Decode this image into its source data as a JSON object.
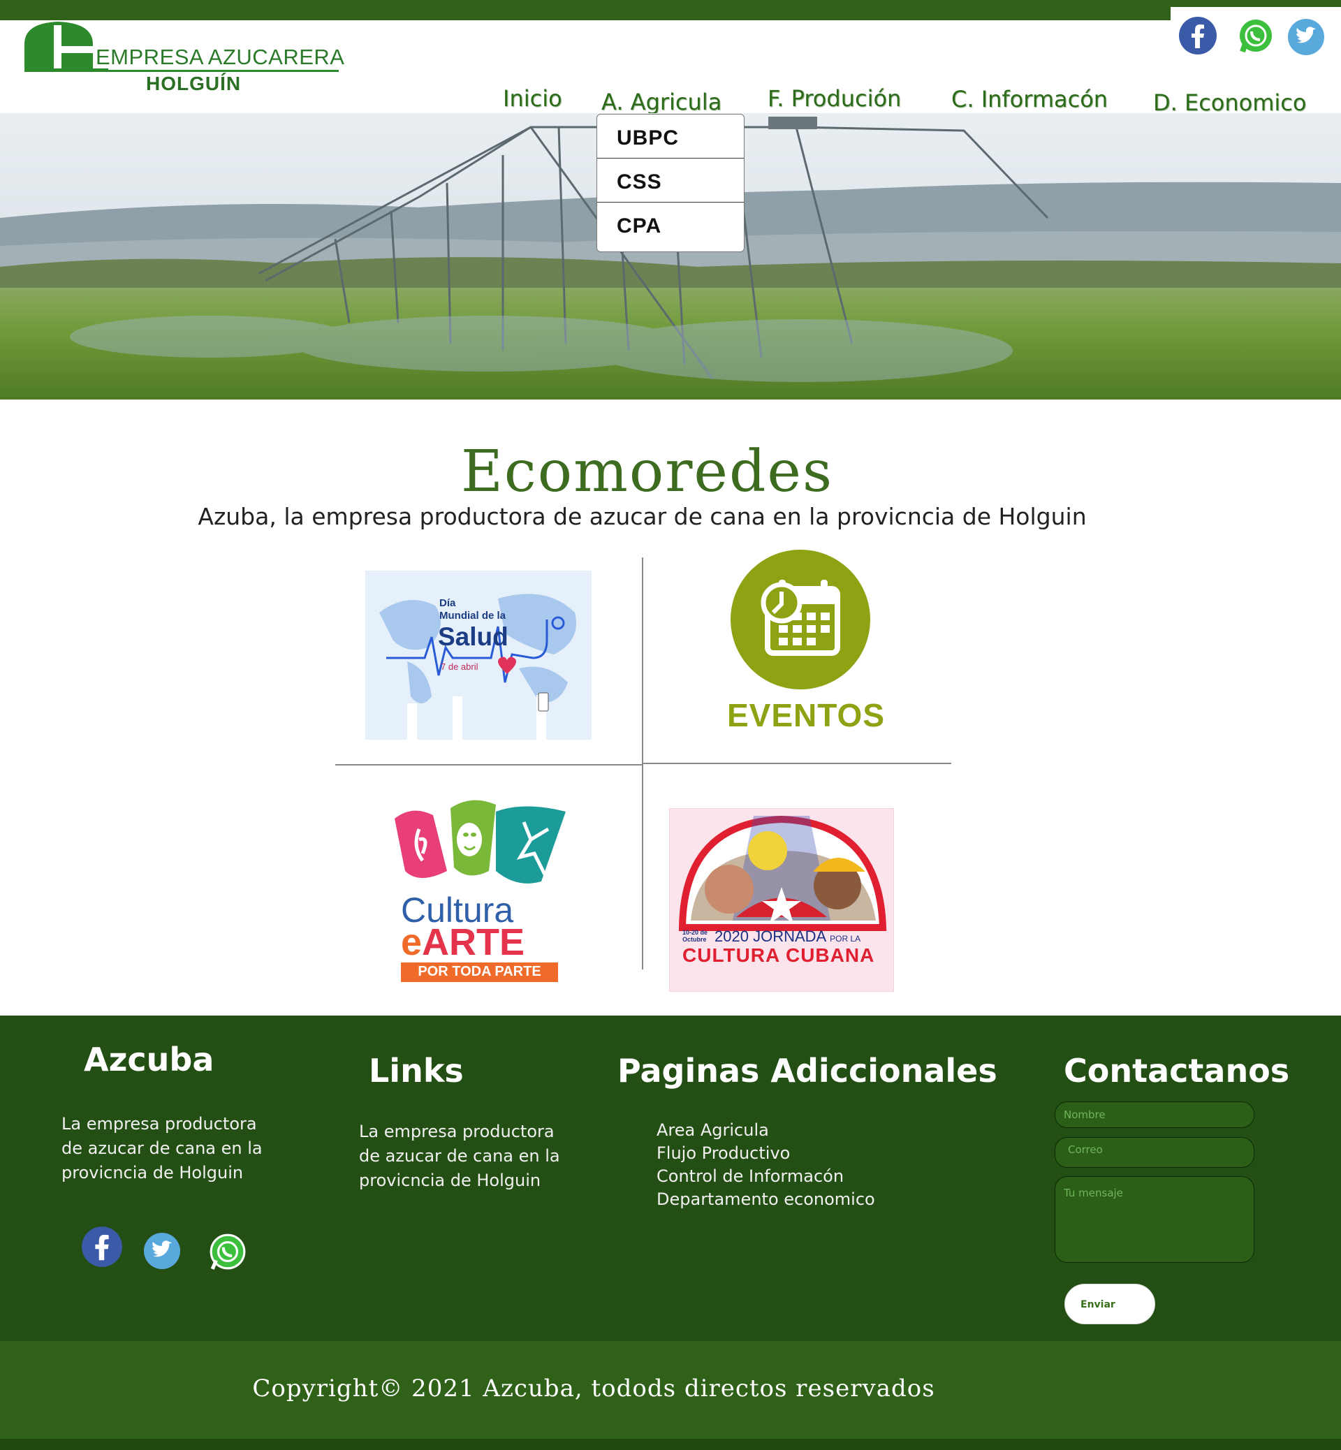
{
  "brand": {
    "line1": "EMPRESA AZUCARERA",
    "line2": "HOLGUÍN"
  },
  "nav": {
    "items": [
      "Inicio",
      "A. Agricula",
      "F. Produción",
      "C. Informacón",
      "D. Economico"
    ]
  },
  "dropdown": {
    "options": [
      "UBPC",
      "CSS",
      "CPA"
    ]
  },
  "main": {
    "title": "Ecomoredes",
    "subtitle": "Azuba, la empresa productora de azucar de cana en la provicncia de Holguin"
  },
  "cards": {
    "salud": {
      "line1": "Día",
      "line2": "Mundial de la",
      "line3": "Salud",
      "date": "7 de abril"
    },
    "eventos": {
      "label": "EVENTOS"
    },
    "cultura": {
      "line1": "Cultura",
      "line2": "e",
      "line3": "ARTE",
      "line4": "POR TODA PARTE"
    },
    "jornada": {
      "dates": "10-20 de Octubre",
      "year": "2020",
      "line1": "JORNADA",
      "line1b": "POR LA",
      "line2": "CULTURA CUBANA"
    }
  },
  "footer": {
    "col1": {
      "title": "Azcuba",
      "text": [
        "La empresa productora",
        "de azucar de cana en la",
        "provicncia de Holguin"
      ]
    },
    "col2": {
      "title": "Links",
      "text": [
        "La empresa productora",
        "de azucar de cana en la",
        "provicncia de Holguin"
      ]
    },
    "col3": {
      "title": "Paginas Adiccionales",
      "links": [
        "Area Agricula",
        "Flujo Productivo",
        "Control de Informacón",
        "Departamento economico"
      ]
    },
    "col4": {
      "title": "Contactanos",
      "name_placeholder": "Nombre",
      "email_placeholder": "Correo",
      "message_placeholder": "Tu mensaje",
      "send_label": "Enviar"
    },
    "copyright": "Copyright© 2021 Azcuba,  todods directos reservados"
  },
  "colors": {
    "brand_green": "#2f6119",
    "footer_green": "#234f14",
    "title_green": "#3d6b1f",
    "eventos_green": "#8a9f14"
  },
  "icons": [
    "facebook-icon",
    "whatsapp-icon",
    "twitter-icon"
  ]
}
